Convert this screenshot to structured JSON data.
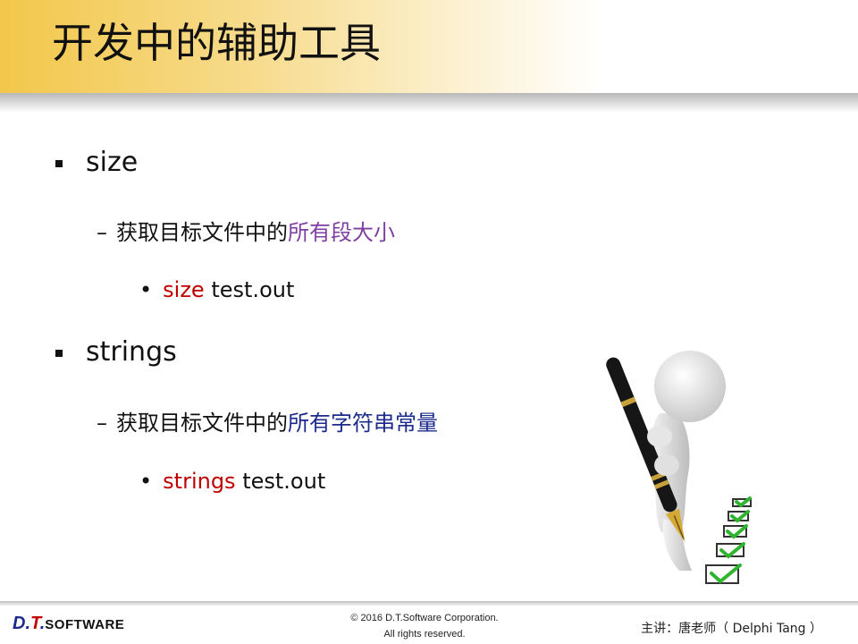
{
  "slide": {
    "title": "开发中的辅助工具"
  },
  "content": {
    "items": [
      {
        "label": "size",
        "sub_prefix": "获取目标文件中的",
        "sub_highlight": "所有段大小",
        "cmd_keyword": "size",
        "cmd_arg": "test.out"
      },
      {
        "label": "strings",
        "sub_prefix": "获取目标文件中的",
        "sub_highlight": "所有字符串常量",
        "cmd_keyword": "strings",
        "cmd_arg": "test.out"
      }
    ],
    "dash_glyph": "–",
    "dot_glyph": "•"
  },
  "footer": {
    "logo_dt_d": "D.",
    "logo_dt_t": "T",
    "logo_dt_dot": ".",
    "logo_software": "SOFTWARE",
    "copyright_line1": "© 2016 D.T.Software Corporation.",
    "copyright_line2": "All rights reserved.",
    "lecturer": "主讲：唐老师（ Delphi Tang ）"
  },
  "colors": {
    "header_gold": "#f2c74a",
    "highlight_purple": "#7f3fa0",
    "highlight_navy": "#1b2a8c",
    "command_red": "#c00000"
  },
  "illustration": {
    "icon": "person-with-pen-checklist-icon"
  }
}
